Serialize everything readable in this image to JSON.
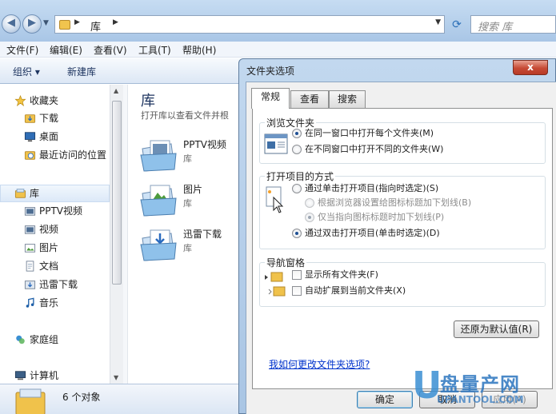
{
  "address_bar": {
    "crumb": "库",
    "search_placeholder": "搜索 库"
  },
  "menubar": {
    "items": [
      "文件(F)",
      "编辑(E)",
      "查看(V)",
      "工具(T)",
      "帮助(H)"
    ]
  },
  "toolbar": {
    "organize": "组织 ▾",
    "new_library": "新建库"
  },
  "sidebar": {
    "items": [
      {
        "label": "收藏夹",
        "icon": "star-icon"
      },
      {
        "label": "下载",
        "icon": "download-folder-icon"
      },
      {
        "label": "桌面",
        "icon": "desktop-icon"
      },
      {
        "label": "最近访问的位置",
        "icon": "recent-places-icon"
      },
      {
        "label": "库",
        "icon": "library-icon"
      },
      {
        "label": "PPTV视频",
        "icon": "video-library-icon"
      },
      {
        "label": "视频",
        "icon": "video-library-icon"
      },
      {
        "label": "图片",
        "icon": "pictures-library-icon"
      },
      {
        "label": "文档",
        "icon": "documents-library-icon"
      },
      {
        "label": "迅雷下载",
        "icon": "download-library-icon"
      },
      {
        "label": "音乐",
        "icon": "music-icon"
      },
      {
        "label": "家庭组",
        "icon": "homegroup-icon"
      },
      {
        "label": "计算机",
        "icon": "computer-icon"
      }
    ]
  },
  "content": {
    "title": "库",
    "subtitle": "打开库以查看文件并根",
    "items": [
      {
        "name": "PPTV视频",
        "type": "库"
      },
      {
        "name": "图片",
        "type": "库"
      },
      {
        "name": "迅雷下载",
        "type": "库"
      }
    ]
  },
  "status": {
    "count": "6 个对象"
  },
  "dialog": {
    "title": "文件夹选项",
    "close": "x",
    "tabs": [
      "常规",
      "查看",
      "搜索"
    ],
    "browse": {
      "title": "浏览文件夹",
      "opt_same": "在同一窗口中打开每个文件夹(M)",
      "opt_new": "在不同窗口中打开不同的文件夹(W)"
    },
    "click": {
      "title": "打开项目的方式",
      "opt_single": "通过单击打开项目(指向时选定)(S)",
      "opt_browser": "根据浏览器设置给图标标题加下划线(B)",
      "opt_hover": "仅当指向图标标题时加下划线(P)",
      "opt_double": "通过双击打开项目(单击时选定)(D)"
    },
    "nav": {
      "title": "导航窗格",
      "opt_all": "显示所有文件夹(F)",
      "opt_expand": "自动扩展到当前文件夹(X)"
    },
    "restore_button": "还原为默认值(R)",
    "help_link": "我如何更改文件夹选项?",
    "ok": "确定",
    "cancel": "取消",
    "apply": "应用(A)"
  },
  "watermark": {
    "letter": "U",
    "brand": "盘量产网",
    "url": "UPANTOOL.COM"
  },
  "colors": {
    "window_frame": "#a9c6e6",
    "close_button": "#c64a35",
    "link": "#0033cc",
    "radio_dot": "#1e4f94"
  }
}
